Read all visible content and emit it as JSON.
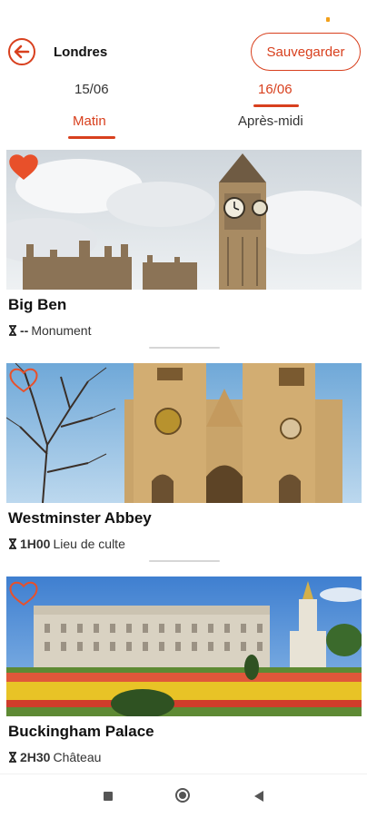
{
  "header": {
    "title": "Londres",
    "save_label": "Sauvegarder"
  },
  "colors": {
    "accent": "#d8401e"
  },
  "date_tabs": [
    {
      "label": "15/06",
      "selected": false
    },
    {
      "label": "16/06",
      "selected": true
    }
  ],
  "period_tabs": [
    {
      "label": "Matin",
      "selected": true
    },
    {
      "label": "Après-midi",
      "selected": false
    }
  ],
  "places": [
    {
      "name": "Big Ben",
      "duration": "--",
      "category": "Monument",
      "favorite": true
    },
    {
      "name": "Westminster Abbey",
      "duration": "1H00",
      "category": "Lieu de culte",
      "favorite": false
    },
    {
      "name": "Buckingham Palace",
      "duration": "2H30",
      "category": "Château",
      "favorite": false
    }
  ],
  "icons": {
    "back": "arrow-left-circle-icon",
    "favorite": "heart-icon",
    "duration": "hourglass-icon"
  }
}
